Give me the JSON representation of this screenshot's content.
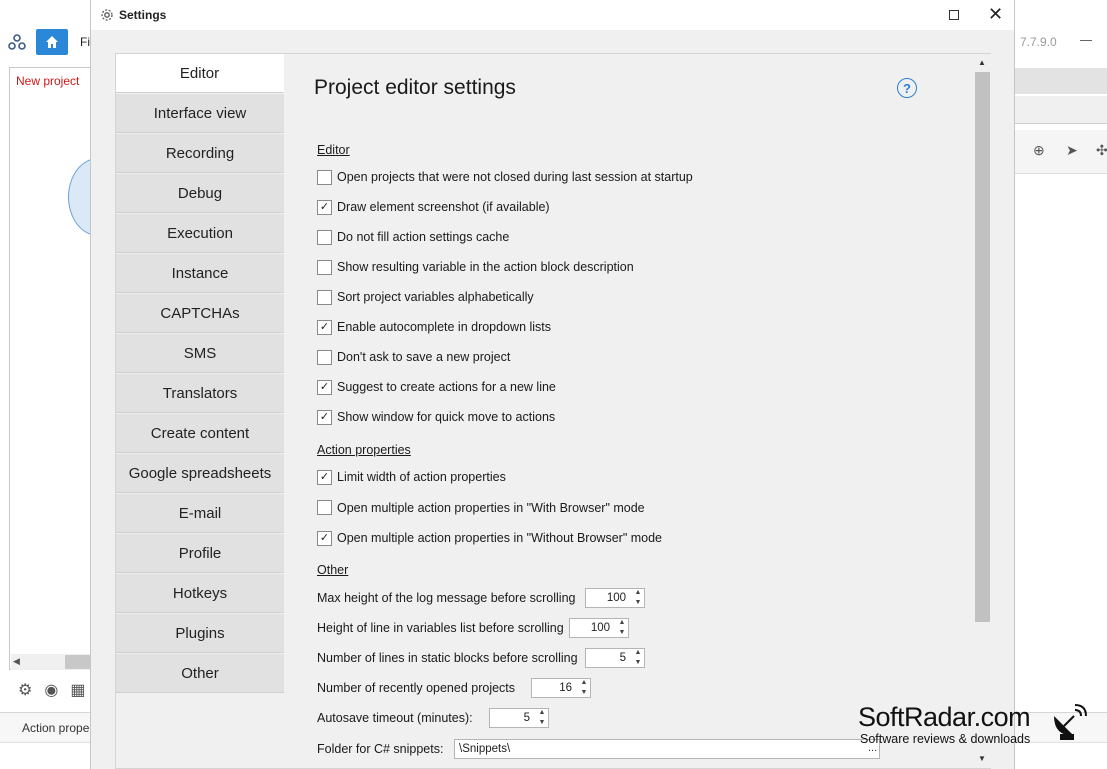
{
  "background_app": {
    "file_menu": "Fil",
    "version": "7.7.9.0",
    "project_tab": "New project",
    "status_text": "Action propert"
  },
  "dialog": {
    "title": "Settings",
    "page_title": "Project editor settings",
    "help_glyph": "?"
  },
  "nav": [
    "Editor",
    "Interface view",
    "Recording",
    "Debug",
    "Execution",
    "Instance",
    "CAPTCHAs",
    "SMS",
    "Translators",
    "Create content",
    "Google spreadsheets",
    "E-mail",
    "Profile",
    "Hotkeys",
    "Plugins",
    "Other"
  ],
  "nav_active": "Editor",
  "sections": {
    "editor": {
      "title": "Editor",
      "options": [
        {
          "label": "Open projects that were not closed during last session at startup",
          "checked": false
        },
        {
          "label": "Draw element screenshot (if available)",
          "checked": true
        },
        {
          "label": "Do not fill action settings cache",
          "checked": false
        },
        {
          "label": "Show resulting variable in the action block description",
          "checked": false
        },
        {
          "label": "Sort project variables alphabetically",
          "checked": false
        },
        {
          "label": "Enable autocomplete in dropdown lists",
          "checked": true
        },
        {
          "label": "Don't ask to save a new project",
          "checked": false
        },
        {
          "label": "Suggest to create actions for a new line",
          "checked": true
        },
        {
          "label": "Show window for quick move to actions",
          "checked": true
        }
      ]
    },
    "action_properties": {
      "title": "Action properties",
      "options": [
        {
          "label": "Limit width of action properties",
          "checked": true
        },
        {
          "label": "Open multiple action properties in \"With Browser\" mode",
          "checked": false
        },
        {
          "label": "Open multiple action properties in \"Without Browser\" mode",
          "checked": true
        }
      ]
    },
    "other": {
      "title": "Other",
      "fields": [
        {
          "label": "Max height of the log message before scrolling",
          "value": "100"
        },
        {
          "label": "Height of line in variables list before scrolling",
          "value": "100"
        },
        {
          "label": "Number of lines in static blocks before scrolling",
          "value": "5"
        },
        {
          "label": "Number of recently opened projects",
          "value": "16"
        },
        {
          "label": "Autosave timeout (minutes):",
          "value": "5"
        }
      ],
      "snippets_label": "Folder for C# snippets:",
      "snippets_value": "\\Snippets\\",
      "snippets_browse": "..."
    }
  },
  "watermark": {
    "title": "SoftRadar.com",
    "subtitle": "Software reviews & downloads"
  },
  "colors": {
    "accent": "#2b88d8",
    "project_tab_text": "#d01818",
    "help_icon": "#2b7fd8"
  }
}
